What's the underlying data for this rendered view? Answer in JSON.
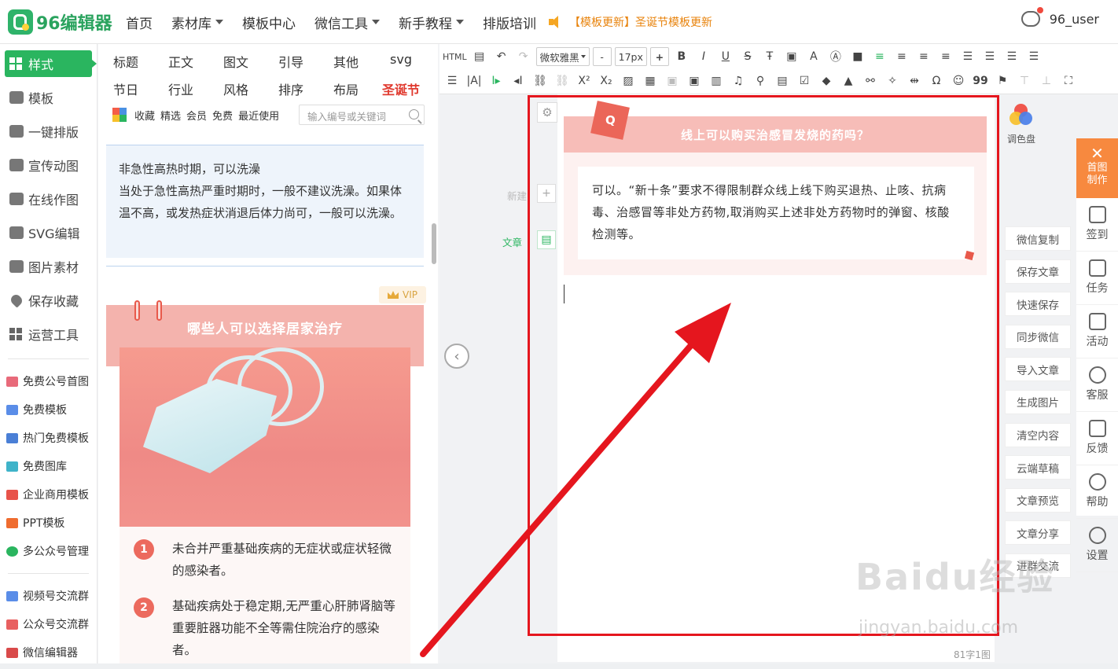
{
  "brand": {
    "logo_text": "96编辑器"
  },
  "nav": {
    "items": [
      {
        "label": "首页",
        "dropdown": false
      },
      {
        "label": "素材库",
        "dropdown": true
      },
      {
        "label": "模板中心",
        "dropdown": false
      },
      {
        "label": "微信工具",
        "dropdown": true
      },
      {
        "label": "新手教程",
        "dropdown": true
      },
      {
        "label": "排版培训",
        "dropdown": false
      }
    ],
    "announcement": "【模板更新】圣诞节模板更新",
    "username": "96_user"
  },
  "sidebar": {
    "main_items": [
      "样式",
      "模板",
      "一键排版",
      "宣传动图",
      "在线作图",
      "SVG编辑",
      "图片素材",
      "保存收藏",
      "运营工具"
    ],
    "links": [
      "免费公号首图",
      "免费模板",
      "热门免费模板",
      "免费图库",
      "企业商用模板",
      "PPT模板",
      "多公众号管理"
    ],
    "groups": [
      "视频号交流群",
      "公众号交流群",
      "微信编辑器"
    ]
  },
  "panel": {
    "categories_row1": [
      "标题",
      "正文",
      "图文",
      "引导",
      "其他",
      "svg"
    ],
    "categories_row2": [
      "节日",
      "行业",
      "风格",
      "排序",
      "布局",
      "圣诞节"
    ],
    "filters": [
      "收藏",
      "精选",
      "会员",
      "免费",
      "最近使用"
    ],
    "search_placeholder": "输入编号或关键词",
    "card1_text": "非急性高热时期，可以洗澡\n当处于急性高热严重时期时，一般不建议洗澡。如果体温不高，或发热症状消退后体力尚可，一般可以洗澡。",
    "vip_label": "VIP",
    "card2_title": "哪些人可以选择居家治疗",
    "card2_list": [
      {
        "num": "1",
        "text": "未合并严重基础疾病的无症状或症状轻微的感染者。"
      },
      {
        "num": "2",
        "text": "基础疾病处于稳定期,无严重心肝肺肾脑等重要脏器功能不全等需住院治疗的感染者。"
      }
    ]
  },
  "toolbar": {
    "font_family": "微软雅黑",
    "font_size": "17px",
    "row1": [
      "HTML",
      "B",
      "I",
      "U",
      "S",
      "A"
    ],
    "row2": [
      "X²",
      "X₂",
      "Ω",
      "99"
    ]
  },
  "editor": {
    "gutter_labels": {
      "new": "新建",
      "article": "文章"
    },
    "question": "线上可以购买治感冒发烧的药吗？",
    "q_badge": "Q",
    "answer": "可以。“新十条”要求不得限制群众线上线下购买退热、止咳、抗病毒、治感冒等非处方药物,取消购买上述非处方药物时的弹窗、核酸检测等。",
    "word_count": "81字1图"
  },
  "right_panel": {
    "palette_label": "调色盘",
    "actions": [
      "微信复制",
      "保存文章",
      "快速保存",
      "同步微信",
      "导入文章",
      "生成图片",
      "清空内容",
      "云端草稿",
      "文章预览",
      "文章分享",
      "进群交流"
    ],
    "rail_top": "首图\n制作",
    "rail": [
      "签到",
      "任务",
      "活动",
      "客服",
      "反馈",
      "帮助",
      "设置"
    ]
  },
  "watermark": {
    "line1": "Baidu经验",
    "line2": "jingyan.baidu.com"
  },
  "colors": {
    "brand_green": "#2ab55f",
    "accent_orange": "#f7893f",
    "annotation_red": "#e5161e",
    "card_pink": "#f4b3ad"
  }
}
